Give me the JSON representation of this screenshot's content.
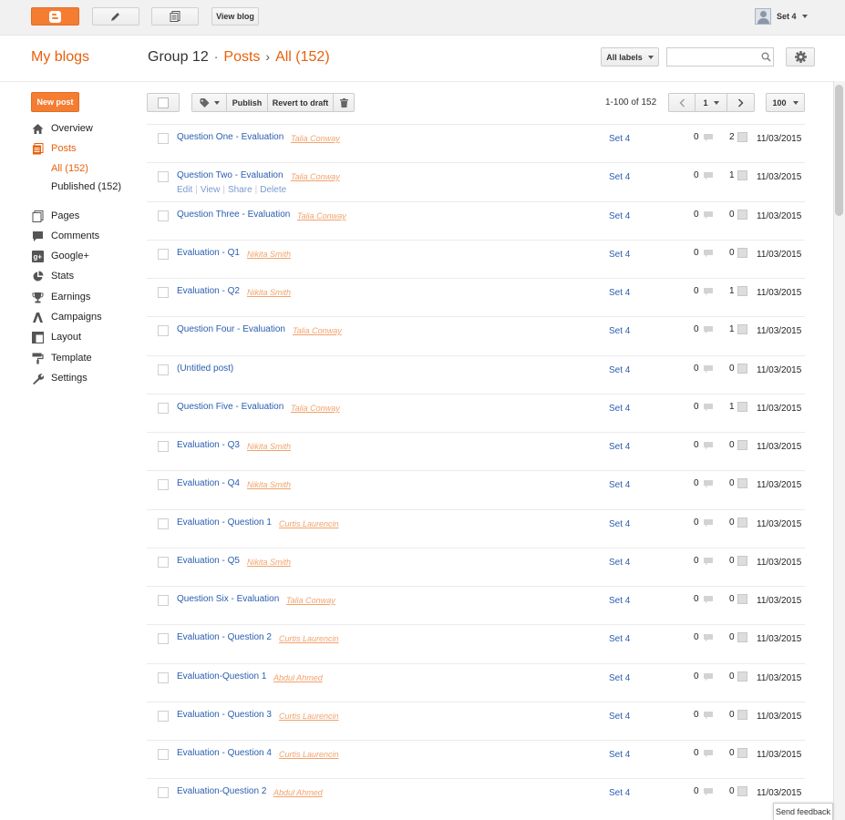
{
  "topbar": {
    "view_blog_label": "View blog",
    "user_name": "Set 4"
  },
  "header": {
    "my_blogs": "My blogs",
    "blog_name": "Group 12",
    "posts_crumb": "Posts",
    "filter_crumb": "All (152)",
    "labels_dropdown": "All labels",
    "search_placeholder": ""
  },
  "sidebar": {
    "new_post_label": "New post",
    "overview": "Overview",
    "posts": "Posts",
    "all": "All (152)",
    "published": "Published (152)",
    "pages": "Pages",
    "comments": "Comments",
    "google_plus": "Google+",
    "stats": "Stats",
    "earnings": "Earnings",
    "campaigns": "Campaigns",
    "layout": "Layout",
    "template": "Template",
    "settings": "Settings"
  },
  "toolbar": {
    "publish_label": "Publish",
    "revert_label": "Revert to draft",
    "page_count": "1-100 of 152",
    "page_number": "1",
    "per_page": "100"
  },
  "row_actions": {
    "edit": "Edit",
    "view": "View",
    "share": "Share",
    "delete": "Delete"
  },
  "posts": [
    {
      "title": "Question One - Evaluation",
      "author": "Talia Conway",
      "blog": "Set 4",
      "comments": "0",
      "views": "2",
      "date": "11/03/2015"
    },
    {
      "title": "Question Two - Evaluation",
      "author": "Talia Conway",
      "blog": "Set 4",
      "comments": "0",
      "views": "1",
      "date": "11/03/2015"
    },
    {
      "title": "Question Three - Evaluation",
      "author": "Talia Conway",
      "blog": "Set 4",
      "comments": "0",
      "views": "0",
      "date": "11/03/2015"
    },
    {
      "title": "Evaluation - Q1",
      "author": "Nikita Smith",
      "blog": "Set 4",
      "comments": "0",
      "views": "0",
      "date": "11/03/2015"
    },
    {
      "title": "Evaluation - Q2",
      "author": "Nikita Smith",
      "blog": "Set 4",
      "comments": "0",
      "views": "1",
      "date": "11/03/2015"
    },
    {
      "title": "Question Four - Evaluation",
      "author": "Talia Conway",
      "blog": "Set 4",
      "comments": "0",
      "views": "1",
      "date": "11/03/2015"
    },
    {
      "title": "(Untitled post)",
      "author": "",
      "blog": "Set 4",
      "comments": "0",
      "views": "0",
      "date": "11/03/2015"
    },
    {
      "title": "Question Five - Evaluation",
      "author": "Talia Conway",
      "blog": "Set 4",
      "comments": "0",
      "views": "1",
      "date": "11/03/2015"
    },
    {
      "title": "Evaluation - Q3",
      "author": "Nikita Smith",
      "blog": "Set 4",
      "comments": "0",
      "views": "0",
      "date": "11/03/2015"
    },
    {
      "title": "Evaluation - Q4",
      "author": "Nikita Smith",
      "blog": "Set 4",
      "comments": "0",
      "views": "0",
      "date": "11/03/2015"
    },
    {
      "title": "Evaluation - Question 1",
      "author": "Curtis Laurencin",
      "blog": "Set 4",
      "comments": "0",
      "views": "0",
      "date": "11/03/2015"
    },
    {
      "title": "Evaluation - Q5",
      "author": "Nikita Smith",
      "blog": "Set 4",
      "comments": "0",
      "views": "0",
      "date": "11/03/2015"
    },
    {
      "title": "Question Six - Evaluation",
      "author": "Talia Conway",
      "blog": "Set 4",
      "comments": "0",
      "views": "0",
      "date": "11/03/2015"
    },
    {
      "title": "Evaluation - Question 2",
      "author": "Curtis Laurencin",
      "blog": "Set 4",
      "comments": "0",
      "views": "0",
      "date": "11/03/2015"
    },
    {
      "title": "Evaluation-Question 1",
      "author": "Abdul Ahmed",
      "blog": "Set 4",
      "comments": "0",
      "views": "0",
      "date": "11/03/2015"
    },
    {
      "title": "Evaluation - Question 3",
      "author": "Curtis Laurencin",
      "blog": "Set 4",
      "comments": "0",
      "views": "0",
      "date": "11/03/2015"
    },
    {
      "title": "Evaluation - Question 4",
      "author": "Curtis Laurencin",
      "blog": "Set 4",
      "comments": "0",
      "views": "0",
      "date": "11/03/2015"
    },
    {
      "title": "Evaluation-Question 2",
      "author": "Abdul Ahmed",
      "blog": "Set 4",
      "comments": "0",
      "views": "0",
      "date": "11/03/2015"
    }
  ],
  "hovered_row_index": 1,
  "feedback_label": "Send feedback",
  "colors": {
    "brand_orange": "#f57d32",
    "link_blue": "#2a5db0",
    "author_orange": "#f2a26b"
  }
}
